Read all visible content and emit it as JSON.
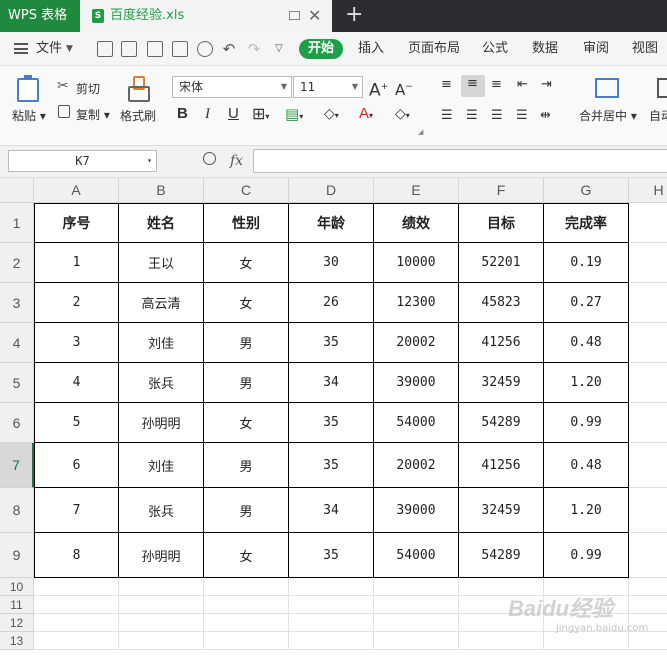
{
  "titlebar": {
    "app": "WPS 表格",
    "file_name": "百度经验.xls",
    "file_icon_letter": "S"
  },
  "menubar": {
    "file": "文件",
    "tabs": [
      "开始",
      "插入",
      "页面布局",
      "公式",
      "数据",
      "审阅",
      "视图"
    ]
  },
  "toolbar": {
    "paste": "粘贴",
    "cut": "剪切",
    "copy": "复制",
    "format_painter": "格式刷",
    "font_name": "宋体",
    "font_size": "11",
    "merge_center": "合并居中",
    "auto_wrap": "自动"
  },
  "formulabar": {
    "cell_ref": "K7",
    "fx": "fx",
    "value": ""
  },
  "columns": [
    "A",
    "B",
    "C",
    "D",
    "E",
    "F",
    "G",
    "H"
  ],
  "row_numbers": [
    "1",
    "2",
    "3",
    "4",
    "5",
    "6",
    "7",
    "8",
    "9",
    "10",
    "11",
    "12",
    "13"
  ],
  "active_row": "7",
  "table": {
    "headers": [
      "序号",
      "姓名",
      "性别",
      "年龄",
      "绩效",
      "目标",
      "完成率"
    ],
    "rows": [
      [
        "1",
        "王以",
        "女",
        "30",
        "10000",
        "52201",
        "0.19"
      ],
      [
        "2",
        "高云清",
        "女",
        "26",
        "12300",
        "45823",
        "0.27"
      ],
      [
        "3",
        "刘佳",
        "男",
        "35",
        "20002",
        "41256",
        "0.48"
      ],
      [
        "4",
        "张兵",
        "男",
        "34",
        "39000",
        "32459",
        "1.20"
      ],
      [
        "5",
        "孙明明",
        "女",
        "35",
        "54000",
        "54289",
        "0.99"
      ],
      [
        "6",
        "刘佳",
        "男",
        "35",
        "20002",
        "41256",
        "0.48"
      ],
      [
        "7",
        "张兵",
        "男",
        "34",
        "39000",
        "32459",
        "1.20"
      ],
      [
        "8",
        "孙明明",
        "女",
        "35",
        "54000",
        "54289",
        "0.99"
      ]
    ]
  },
  "watermark": {
    "text": "Baidu经验",
    "sub": "jingyan.baidu.com"
  },
  "colors": {
    "accent": "#1fa048",
    "app_tab": "#1f8a3e",
    "grid_line": "#e1e1e1"
  }
}
